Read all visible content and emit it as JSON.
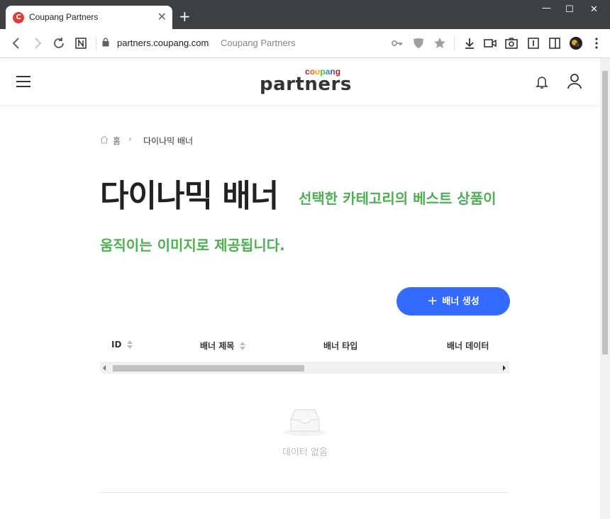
{
  "browser": {
    "tab_title": "Coupang Partners",
    "tab_favicon_letter": "C",
    "url_domain": "partners.coupang.com",
    "url_site_name": "Coupang Partners"
  },
  "header": {
    "logo_small": "coupang",
    "logo_big": "partners",
    "logo_colors": [
      "#ae1f23",
      "#e85c1a",
      "#f5b400",
      "#50b848",
      "#1a9bdc",
      "#7c3d96",
      "#ae1f23"
    ]
  },
  "breadcrumb": {
    "home_label": "홈",
    "current": "다이나믹 배너"
  },
  "page": {
    "title": "다이나믹 배너",
    "description_line1": "선택한 카테고리의 베스트 상품이",
    "description_line2": "움직이는 이미지로 제공됩니다.",
    "accent_color": "#4caf50"
  },
  "actions": {
    "create_label": "배너 생성",
    "button_color": "#346aff"
  },
  "table": {
    "columns": [
      {
        "label": "ID",
        "sortable": true
      },
      {
        "label": "배너 제목",
        "sortable": true
      },
      {
        "label": "배너 타입",
        "sortable": false
      },
      {
        "label": "배너 데이터",
        "sortable": false
      }
    ],
    "empty_text": "데이터 없음"
  }
}
